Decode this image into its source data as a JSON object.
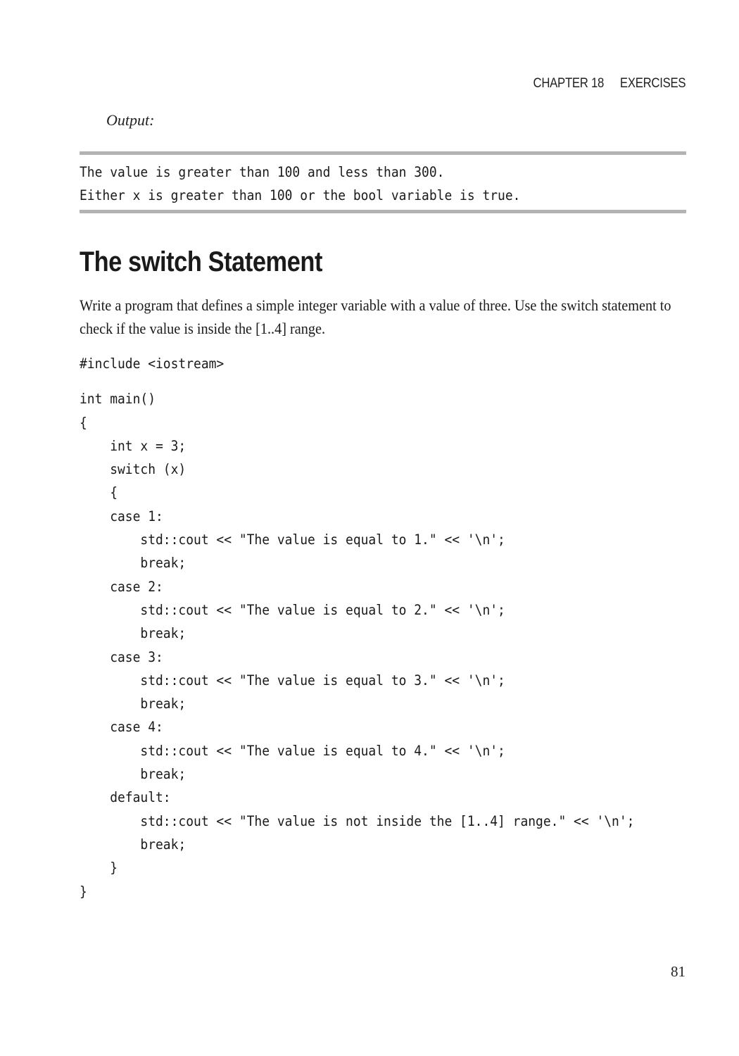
{
  "running_head": {
    "chapter": "CHAPTER 18",
    "title": "EXERCISES"
  },
  "output_label": "Output:",
  "output_lines": [
    "The value is greater than 100 and less than 300.",
    "Either x is greater than 100 or the bool variable is true."
  ],
  "section_heading": "The switch Statement",
  "body_paragraph": "Write a program that defines a simple integer variable with a value of three. Use the switch statement to check if the value is inside the [1..4] range.",
  "code_include": "#include <iostream>",
  "code_lines": [
    "int main()",
    "{",
    "    int x = 3;",
    "    switch (x)",
    "    {",
    "    case 1:",
    "        std::cout << \"The value is equal to 1.\" << '\\n';",
    "        break;",
    "    case 2:",
    "        std::cout << \"The value is equal to 2.\" << '\\n';",
    "        break;",
    "    case 3:",
    "        std::cout << \"The value is equal to 3.\" << '\\n';",
    "        break;",
    "    case 4:",
    "        std::cout << \"The value is equal to 4.\" << '\\n';",
    "        break;",
    "    default:",
    "        std::cout << \"The value is not inside the [1..4] range.\" << '\\n';",
    "        break;",
    "    }",
    "}"
  ],
  "page_number": "81"
}
